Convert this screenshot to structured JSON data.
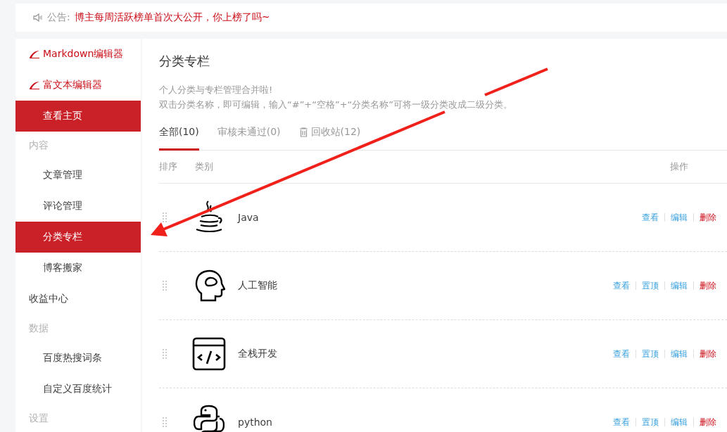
{
  "notice": {
    "label": "公告:",
    "text": "博主每周活跃榜单首次大公开，你上榜了吗~"
  },
  "sidebar": {
    "items": [
      {
        "kind": "editor",
        "label": "Markdown编辑器"
      },
      {
        "kind": "editor",
        "label": "富文本编辑器"
      },
      {
        "kind": "button",
        "label": "查看主页"
      },
      {
        "kind": "section",
        "label": "内容"
      },
      {
        "kind": "item",
        "label": "文章管理",
        "selected": false
      },
      {
        "kind": "item",
        "label": "评论管理",
        "selected": false
      },
      {
        "kind": "item",
        "label": "分类专栏",
        "selected": true
      },
      {
        "kind": "item",
        "label": "博客搬家",
        "selected": false
      },
      {
        "kind": "top",
        "label": "收益中心",
        "selected": false
      },
      {
        "kind": "section",
        "label": "数据"
      },
      {
        "kind": "item",
        "label": "百度热搜词条",
        "selected": false
      },
      {
        "kind": "item",
        "label": "自定义百度统计",
        "selected": false
      },
      {
        "kind": "section",
        "label": "设置"
      }
    ]
  },
  "page": {
    "title": "分类专栏",
    "description": [
      "个人分类与专栏管理合并啦!",
      "双击分类名称，即可编辑，输入“#”+“空格”+“分类名称”可将一级分类改成二级分类。"
    ],
    "tabs": [
      {
        "label": "全部(10)",
        "selected": true
      },
      {
        "label": "审核未通过(0)",
        "selected": false
      },
      {
        "label": "回收站(12)",
        "selected": false,
        "kind": "trash"
      }
    ],
    "table": {
      "columns": [
        "排序",
        "类别",
        "操作"
      ],
      "rows": [
        {
          "name": "Java",
          "actions": [
            {
              "label": "查看",
              "kind": "link"
            },
            {
              "label": "编辑",
              "kind": "link"
            },
            {
              "label": "删除",
              "kind": "danger"
            }
          ]
        },
        {
          "name": "人工智能",
          "actions": [
            {
              "label": "查看",
              "kind": "link"
            },
            {
              "label": "置顶",
              "kind": "link"
            },
            {
              "label": "编辑",
              "kind": "link"
            },
            {
              "label": "删除",
              "kind": "danger"
            }
          ]
        },
        {
          "name": "全栈开发",
          "actions": [
            {
              "label": "查看",
              "kind": "link"
            },
            {
              "label": "置顶",
              "kind": "link"
            },
            {
              "label": "编辑",
              "kind": "link"
            },
            {
              "label": "删除",
              "kind": "danger"
            }
          ]
        },
        {
          "name": "python",
          "actions": [
            {
              "label": "查看",
              "kind": "link"
            },
            {
              "label": "置顶",
              "kind": "link"
            },
            {
              "label": "编辑",
              "kind": "link"
            },
            {
              "label": "删除",
              "kind": "danger"
            }
          ]
        }
      ]
    }
  }
}
